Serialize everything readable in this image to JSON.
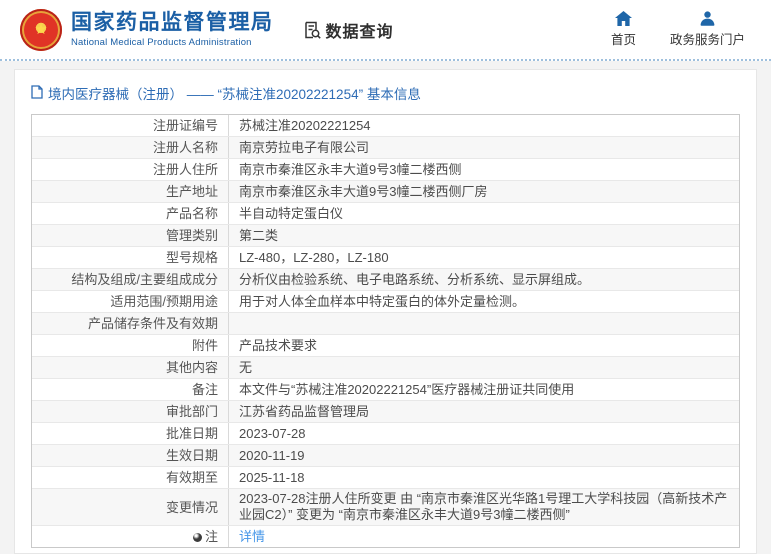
{
  "header": {
    "org_zh": "国家药品监督管理局",
    "org_en": "National Medical Products Administration",
    "query_label": "数据查询",
    "nav": [
      {
        "label": "首页",
        "icon": "home-icon"
      },
      {
        "label": "政务服务门户",
        "icon": "user-icon"
      }
    ]
  },
  "breadcrumb": {
    "text": "境内医疗器械（注册） —— “苏械注准20202221254” 基本信息"
  },
  "table": {
    "rows": [
      {
        "label": "注册证编号",
        "value": "苏械注准20202221254"
      },
      {
        "label": "注册人名称",
        "value": "南京劳拉电子有限公司"
      },
      {
        "label": "注册人住所",
        "value": "南京市秦淮区永丰大道9号3幢二楼西侧"
      },
      {
        "label": "生产地址",
        "value": "南京市秦淮区永丰大道9号3幢二楼西侧厂房"
      },
      {
        "label": "产品名称",
        "value": "半自动特定蛋白仪"
      },
      {
        "label": "管理类别",
        "value": "第二类"
      },
      {
        "label": "型号规格",
        "value": "LZ-480，LZ-280，LZ-180"
      },
      {
        "label": "结构及组成/主要组成成分",
        "value": "分析仪由检验系统、电子电路系统、分析系统、显示屏组成。"
      },
      {
        "label": "适用范围/预期用途",
        "value": "用于对人体全血样本中特定蛋白的体外定量检测。"
      },
      {
        "label": "产品储存条件及有效期",
        "value": ""
      },
      {
        "label": "附件",
        "value": "产品技术要求"
      },
      {
        "label": "其他内容",
        "value": "无"
      },
      {
        "label": "备注",
        "value": "本文件与“苏械注准20202221254”医疗器械注册证共同使用"
      },
      {
        "label": "审批部门",
        "value": "江苏省药品监督管理局"
      },
      {
        "label": "批准日期",
        "value": "2023-07-28"
      },
      {
        "label": "生效日期",
        "value": "2020-11-19"
      },
      {
        "label": "有效期至",
        "value": "2025-11-18"
      },
      {
        "label": "变更情况",
        "value": "2023-07-28注册人住所变更 由 “南京市秦淮区光华路1号理工大学科技园（高新技术产业园C2）” 变更为 “南京市秦淮区永丰大道9号3幢二楼西侧”",
        "multiline": true
      },
      {
        "label": "注",
        "value": "详情",
        "link": true,
        "icon": "bulb-icon"
      }
    ]
  },
  "colors": {
    "brand_blue": "#1b5fa5",
    "breadcrumb_blue": "#2e6cb5",
    "link_blue": "#4596e8",
    "emblem_red": "#e03326",
    "zebra_gray": "#f7f7f7"
  }
}
